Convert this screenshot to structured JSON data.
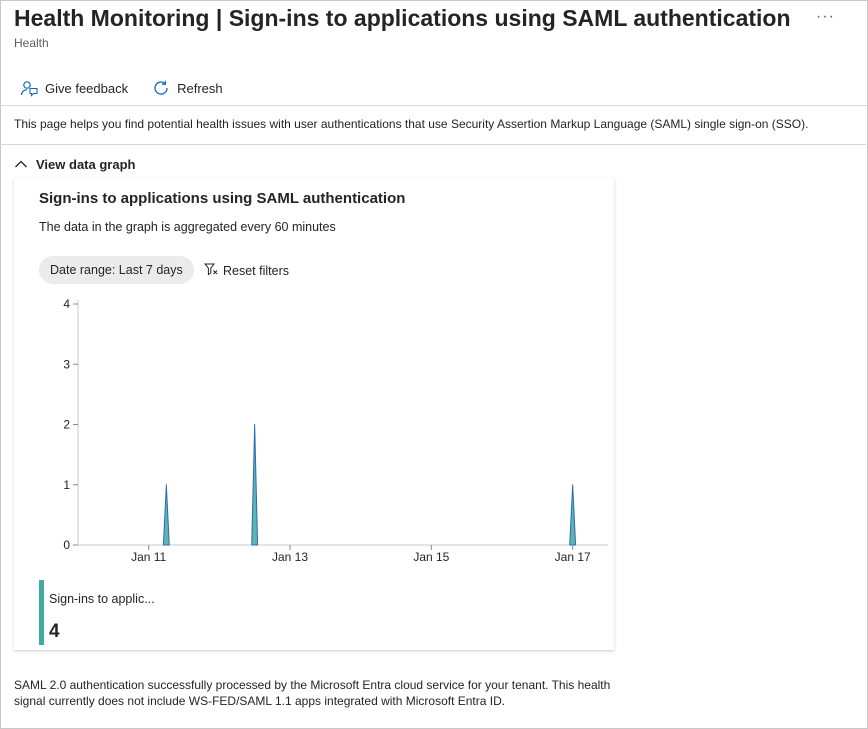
{
  "header": {
    "title": "Health Monitoring | Sign-ins to applications using SAML authentication",
    "subtitle": "Health",
    "more_label": "···"
  },
  "toolbar": {
    "feedback_label": "Give feedback",
    "refresh_label": "Refresh"
  },
  "description": "This page helps you find potential health issues with user authentications that use Security Assertion Markup Language (SAML) single sign-on (SSO).",
  "graph_section": {
    "toggle_label": "View data graph"
  },
  "card": {
    "title": "Sign-ins to applications using SAML authentication",
    "subtitle": "The data in the graph is aggregated every 60 minutes",
    "date_range_label": "Date range: Last 7 days",
    "reset_label": "Reset filters"
  },
  "legend": {
    "label": "Sign-ins to applic...",
    "value": "4"
  },
  "footer": "SAML 2.0 authentication successfully processed by the Microsoft Entra cloud service for your tenant. This health signal currently does not include WS-FED/SAML 1.1 apps integrated with Microsoft Entra ID.",
  "colors": {
    "series_fill": "#5fb4b2",
    "series_stroke": "#2b6cb0",
    "legend_bar": "#3faaa0",
    "axis": "#c8c8c8"
  },
  "chart_data": {
    "type": "area",
    "x_start": "Jan 10 00:00",
    "x_end": "Jan 17 12:00",
    "x_ticks": [
      "Jan 11",
      "Jan 13",
      "Jan 15",
      "Jan 17"
    ],
    "y_ticks": [
      "0",
      "1",
      "2",
      "3",
      "4"
    ],
    "ylim": [
      0,
      4
    ],
    "series": [
      {
        "name": "Sign-ins to applic...",
        "points": [
          {
            "x": "Jan 11 06:00",
            "y": 1
          },
          {
            "x": "Jan 12 12:00",
            "y": 2
          },
          {
            "x": "Jan 17 00:00",
            "y": 1
          }
        ]
      }
    ],
    "total": 4,
    "grid": false
  }
}
